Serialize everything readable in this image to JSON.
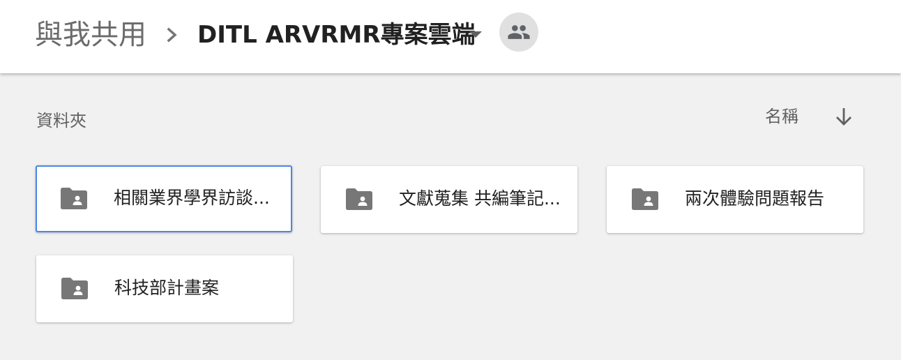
{
  "breadcrumb": {
    "root": "與我共用",
    "separator_icon": "chevron-right-icon",
    "current": "DITL ARVRMR專案雲端",
    "dropdown_icon": "arrow-drop-down-icon",
    "shared_icon": "people-icon"
  },
  "section": {
    "label": "資料夾"
  },
  "sort": {
    "label": "名稱",
    "direction_icon": "arrow-downward-icon"
  },
  "folders": [
    {
      "name": "相關業界學界訪談...",
      "icon": "shared-folder-icon",
      "selected": true
    },
    {
      "name": "文獻蒐集 共編筆記...",
      "icon": "shared-folder-icon",
      "selected": false
    },
    {
      "name": "兩次體驗問題報告",
      "icon": "shared-folder-icon",
      "selected": false
    },
    {
      "name": "科技部計畫案",
      "icon": "shared-folder-icon",
      "selected": false
    }
  ],
  "colors": {
    "selected_border": "#4a86e8",
    "folder_icon": "#777777",
    "background": "#f1f1f1"
  }
}
